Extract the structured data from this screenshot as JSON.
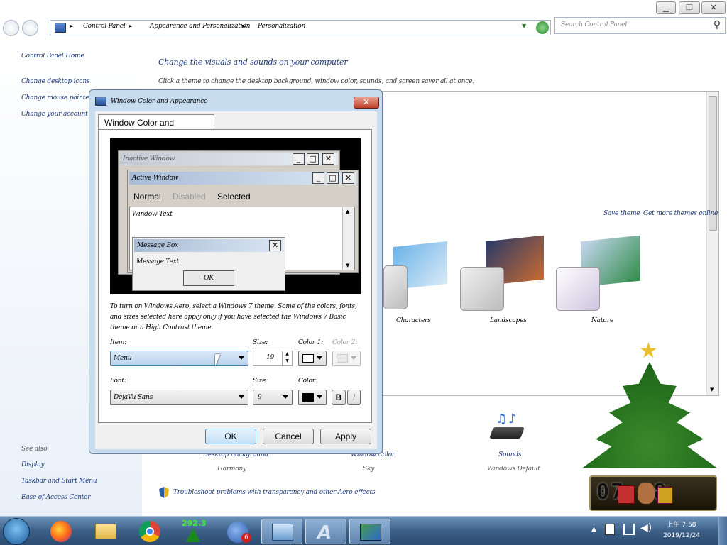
{
  "window": {
    "minimize": "▁",
    "maximize": "❐",
    "close": "✕"
  },
  "address": {
    "crumbs": [
      "Control Panel",
      "Appearance and Personalization",
      "Personalization"
    ],
    "separator": "►",
    "search_placeholder": "Search Control Panel",
    "refresh_icon": "refresh-icon",
    "help": "?"
  },
  "sidebar": {
    "home": "Control Panel Home",
    "links": [
      "Change desktop icons",
      "Change mouse pointers",
      "Change your account picture"
    ],
    "see_also_heading": "See also",
    "see_also": [
      "Display",
      "Taskbar and Start Menu",
      "Ease of Access Center"
    ]
  },
  "main": {
    "heading": "Change the visuals and sounds on your computer",
    "subheading": "Click a theme to change the desktop background, window color, sounds, and screen saver all at once.",
    "save_theme": "Save theme",
    "get_more": "Get more themes online",
    "themes": [
      "Characters",
      "Landscapes",
      "Nature"
    ],
    "bottom_items": [
      {
        "label": "Desktop Background",
        "value": "Harmony"
      },
      {
        "label": "Window Color",
        "value": "Sky"
      },
      {
        "label": "Sounds",
        "value": "Windows Default"
      }
    ],
    "troubleshoot": "Troubleshoot problems with transparency and other Aero effects"
  },
  "dialog": {
    "title": "Window Color and Appearance",
    "tab": "Window Color and Appearance",
    "preview": {
      "inactive": "Inactive Window",
      "active": "Active Window",
      "menu_normal": "Normal",
      "menu_disabled": "Disabled",
      "menu_selected": "Selected",
      "window_text": "Window Text",
      "msgbox_title": "Message Box",
      "msgbox_text": "Message Text",
      "msgbox_ok": "OK"
    },
    "note": "To turn on Windows Aero, select a Windows 7 theme. Some of the colors, fonts, and sizes selected here apply only if you have selected the Windows 7 Basic theme or a High Contrast theme.",
    "item_label": "Item:",
    "item_value": "Menu",
    "size_label": "Size:",
    "size_value": "19",
    "color1_label": "Color 1:",
    "color2_label": "Color 2:",
    "font_label": "Font:",
    "font_value": "DejaVu Sans",
    "font_size_label": "Size:",
    "font_size_value": "9",
    "font_color_label": "Color:",
    "bold": "B",
    "italic": "I",
    "ok": "OK",
    "cancel": "Cancel",
    "apply": "Apply"
  },
  "taskbar": {
    "apps": [
      "start-orb",
      "firefox",
      "file-explorer",
      "chrome",
      "tree-widget",
      "thunderbird",
      "control-panel",
      "app-a",
      "personalization"
    ],
    "tree_count": "292.3",
    "badge": "6",
    "clock_line1": "上午 7:58",
    "clock_line2": "2019/12/24"
  },
  "colors": {
    "accent": "#1e3a78",
    "dialog_frame": "#c8dcf0",
    "taskbar": "#3c5f86"
  }
}
